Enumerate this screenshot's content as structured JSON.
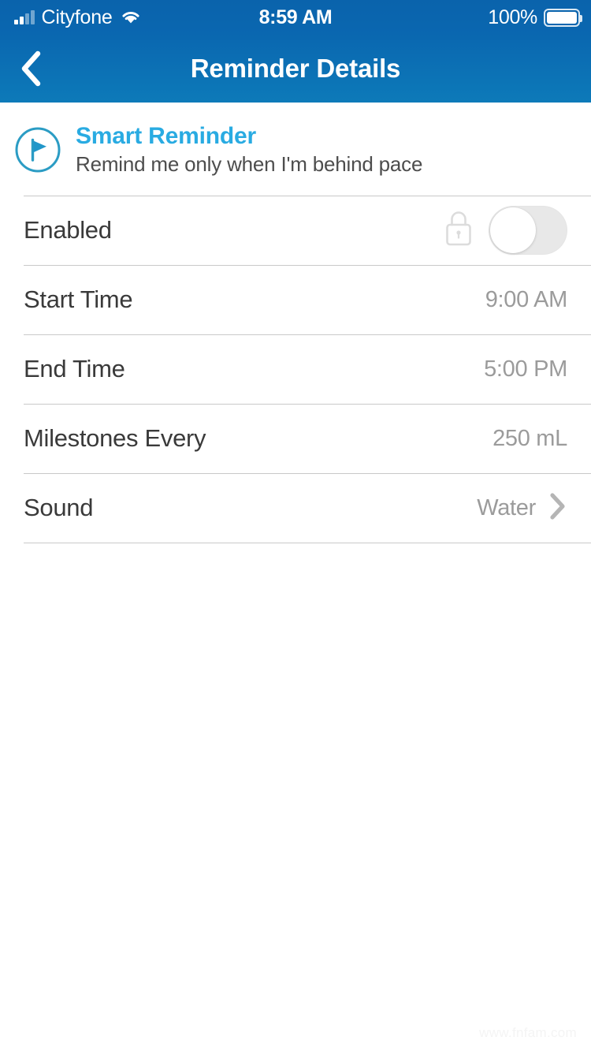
{
  "status_bar": {
    "carrier": "Cityfone",
    "signal_icon": "signal-bars-icon",
    "signal_bars_filled": 2,
    "signal_bars_total": 4,
    "wifi_icon": "wifi-icon",
    "time": "8:59 AM",
    "battery_percent": "100%",
    "battery_icon": "battery-full-icon"
  },
  "navbar": {
    "back_icon": "chevron-left-icon",
    "title": "Reminder Details",
    "background_color": "#0a67b0"
  },
  "smart_reminder": {
    "icon": "flag-circle-icon",
    "title": "Smart Reminder",
    "title_color": "#29abe2",
    "subtitle": "Remind me only when I'm behind pace"
  },
  "settings": {
    "enabled": {
      "label": "Enabled",
      "lock_icon": "lock-closed-icon",
      "toggle_state": "off"
    },
    "rows": [
      {
        "label": "Start Time",
        "value": "9:00 AM",
        "accessory": "none"
      },
      {
        "label": "End Time",
        "value": "5:00 PM",
        "accessory": "none"
      },
      {
        "label": "Milestones Every",
        "value": "250 mL",
        "accessory": "none"
      },
      {
        "label": "Sound",
        "value": "Water",
        "accessory": "chevron-right-icon"
      }
    ]
  },
  "watermark": {
    "text": "www.fnfam.com"
  }
}
